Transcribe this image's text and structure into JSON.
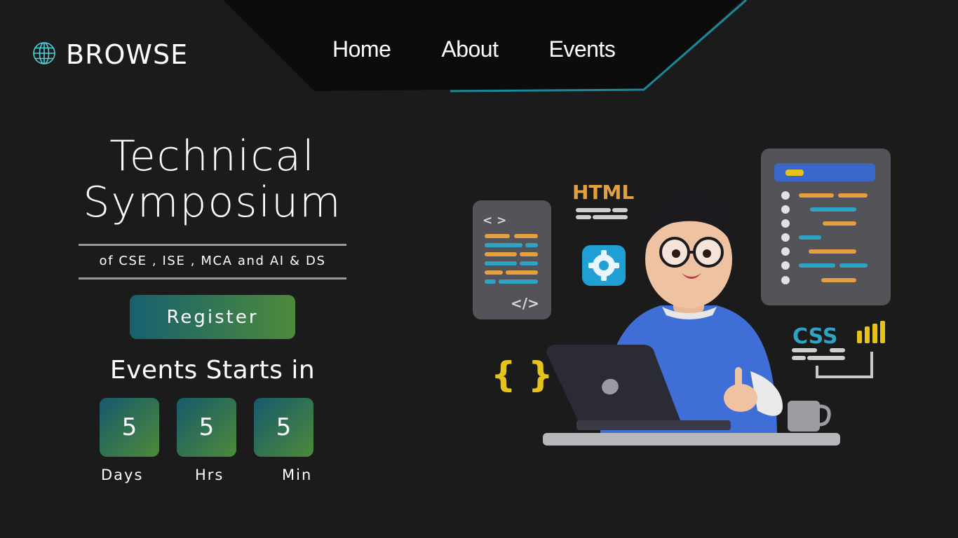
{
  "brand": {
    "name": "BROWSE",
    "icon": "globe-icon"
  },
  "nav": {
    "items": [
      {
        "label": "Home"
      },
      {
        "label": "About"
      },
      {
        "label": "Events"
      }
    ]
  },
  "hero": {
    "title_line1": "Technical",
    "title_line2": "Symposium",
    "subtitle": "of CSE , ISE , MCA and AI & DS",
    "register_label": "Register",
    "countdown_title": "Events Starts in",
    "countdown": [
      {
        "value": "5",
        "unit": "Days"
      },
      {
        "value": "5",
        "unit": "Hrs"
      },
      {
        "value": "5",
        "unit": "Min"
      }
    ]
  },
  "illustration": {
    "html_label": "HTML",
    "css_label": "CSS",
    "code_tag_open": "< >",
    "code_tag_close": "</>",
    "braces": "{ }"
  },
  "colors": {
    "accent": "#1a8a9a",
    "gradient_start": "#17606f",
    "gradient_end": "#4d8a3a",
    "background": "#1b1b1b"
  }
}
